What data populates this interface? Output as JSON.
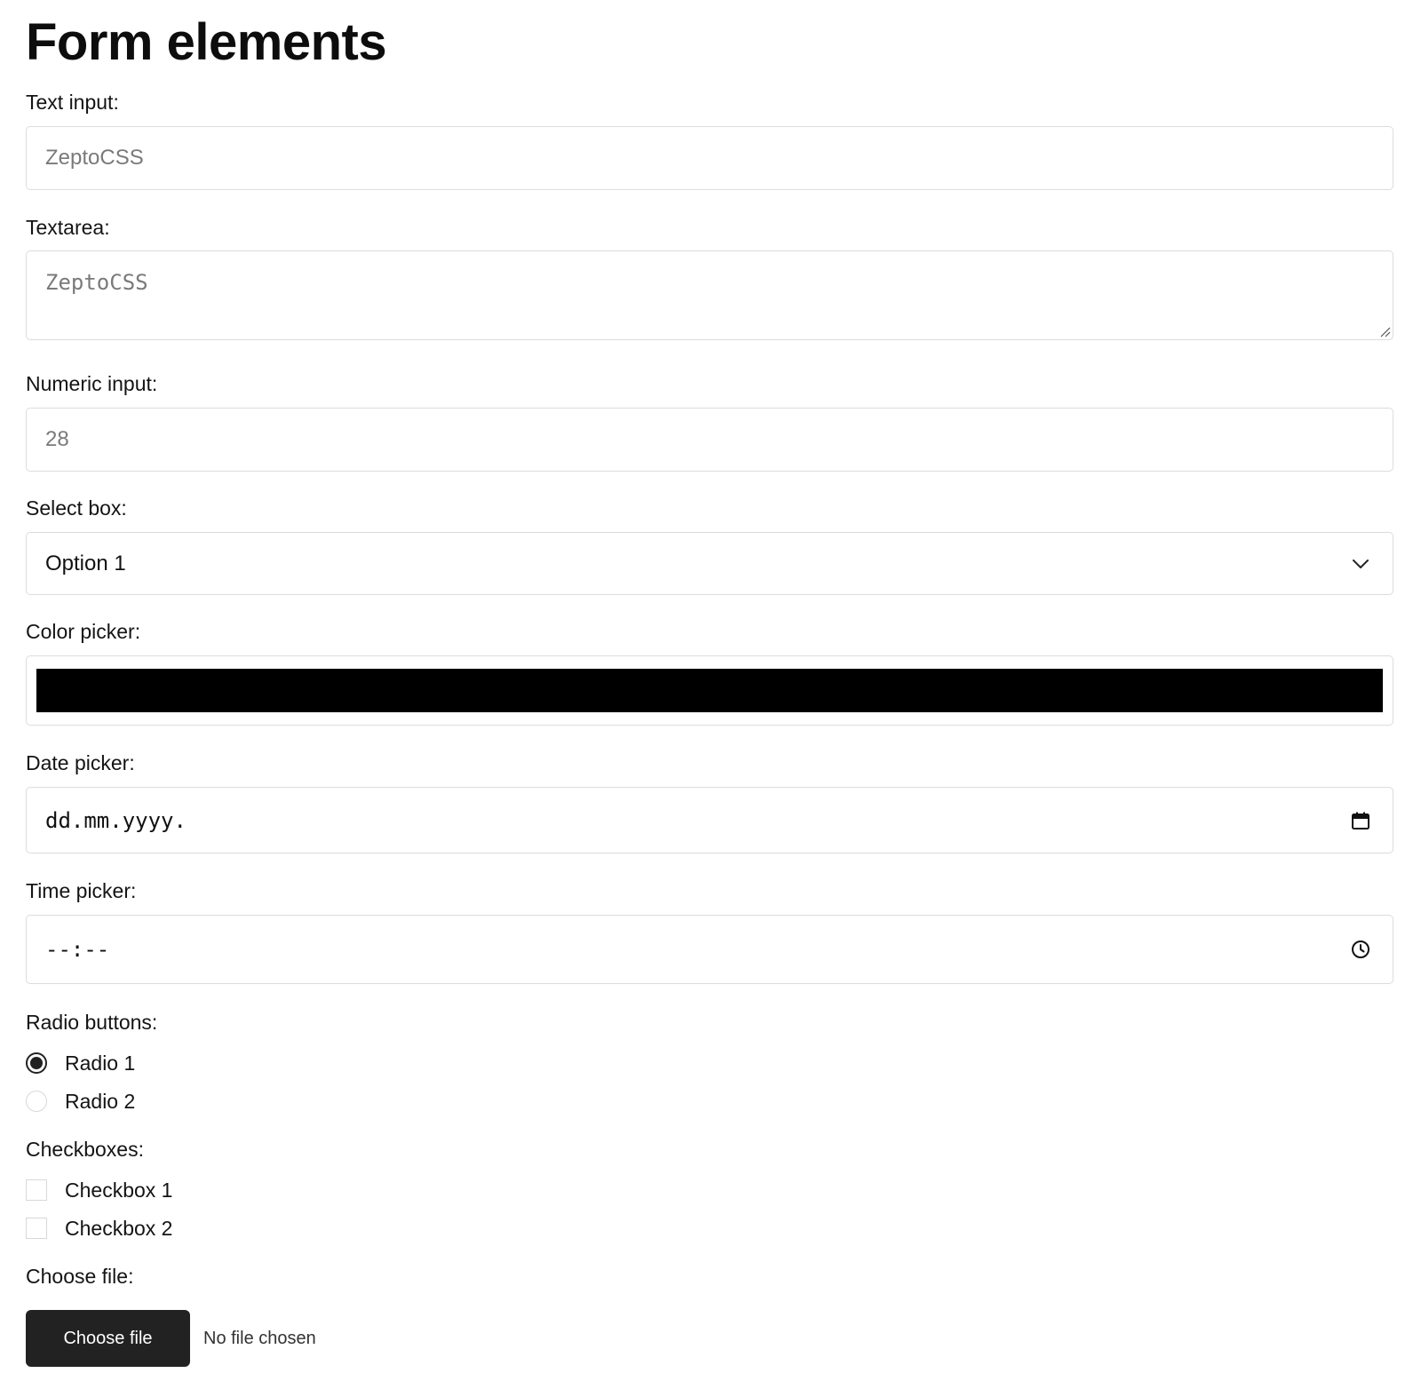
{
  "page": {
    "title": "Form elements"
  },
  "text_input": {
    "label": "Text input:",
    "placeholder": "ZeptoCSS"
  },
  "textarea": {
    "label": "Textarea:",
    "placeholder": "ZeptoCSS"
  },
  "numeric_input": {
    "label": "Numeric input:",
    "placeholder": "28"
  },
  "select_box": {
    "label": "Select box:",
    "selected": "Option 1",
    "icon": "chevron-down-icon"
  },
  "color_picker": {
    "label": "Color picker:",
    "value": "#000000"
  },
  "date_picker": {
    "label": "Date picker:",
    "placeholder": "dd.mm.yyyy.",
    "icon": "calendar-icon"
  },
  "time_picker": {
    "label": "Time picker:",
    "placeholder": "--:--",
    "icon": "clock-icon"
  },
  "radio_buttons": {
    "label": "Radio buttons:",
    "options": [
      {
        "label": "Radio 1",
        "checked": true
      },
      {
        "label": "Radio 2",
        "checked": false
      }
    ]
  },
  "checkboxes": {
    "label": "Checkboxes:",
    "options": [
      {
        "label": "Checkbox 1",
        "checked": false
      },
      {
        "label": "Checkbox 2",
        "checked": false
      }
    ]
  },
  "file_input": {
    "label": "Choose file:",
    "button_label": "Choose file",
    "status": "No file chosen"
  },
  "colors": {
    "text": "#111111",
    "border": "#dcdcdc",
    "placeholder": "#7a7a7a",
    "button_bg": "#222222",
    "button_text": "#ffffff"
  }
}
